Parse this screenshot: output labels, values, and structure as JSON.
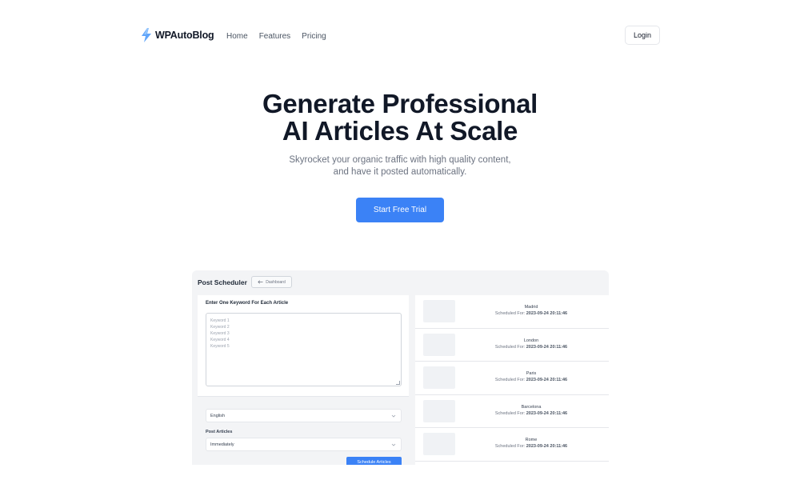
{
  "brand": {
    "name": "WPAutoBlog",
    "icon": "lightning-icon",
    "accent": "#3b82f6"
  },
  "nav": {
    "links": [
      "Home",
      "Features",
      "Pricing"
    ],
    "login_label": "Login"
  },
  "hero": {
    "title_line1": "Generate Professional",
    "title_line2": "AI Articles At Scale",
    "subtitle_line1": "Skyrocket your organic traffic with high quality content,",
    "subtitle_line2": "and have it posted automatically.",
    "cta_label": "Start Free Trial"
  },
  "app": {
    "title": "Post Scheduler",
    "back_button_label": "Dashboard",
    "keywords_label": "Enter One Keyword For Each Article",
    "keyword_placeholders": [
      "Keyword 1",
      "Keyword 2",
      "Keyword 3",
      "Keyword 4",
      "Keyword 5"
    ],
    "language_value": "English",
    "post_articles_label": "Post Articles",
    "post_articles_value": "Immediately",
    "schedule_button_label": "Schedule Articles",
    "scheduled_prefix": "Scheduled For:",
    "scheduled": [
      {
        "city": "Madrid",
        "time": "2023-09-24 20:11:46"
      },
      {
        "city": "London",
        "time": "2023-09-24 20:11:46"
      },
      {
        "city": "Paris",
        "time": "2023-09-24 20:11:46"
      },
      {
        "city": "Barcelona",
        "time": "2023-09-24 20:11:46"
      },
      {
        "city": "Rome",
        "time": "2023-09-24 20:11:46"
      }
    ]
  }
}
